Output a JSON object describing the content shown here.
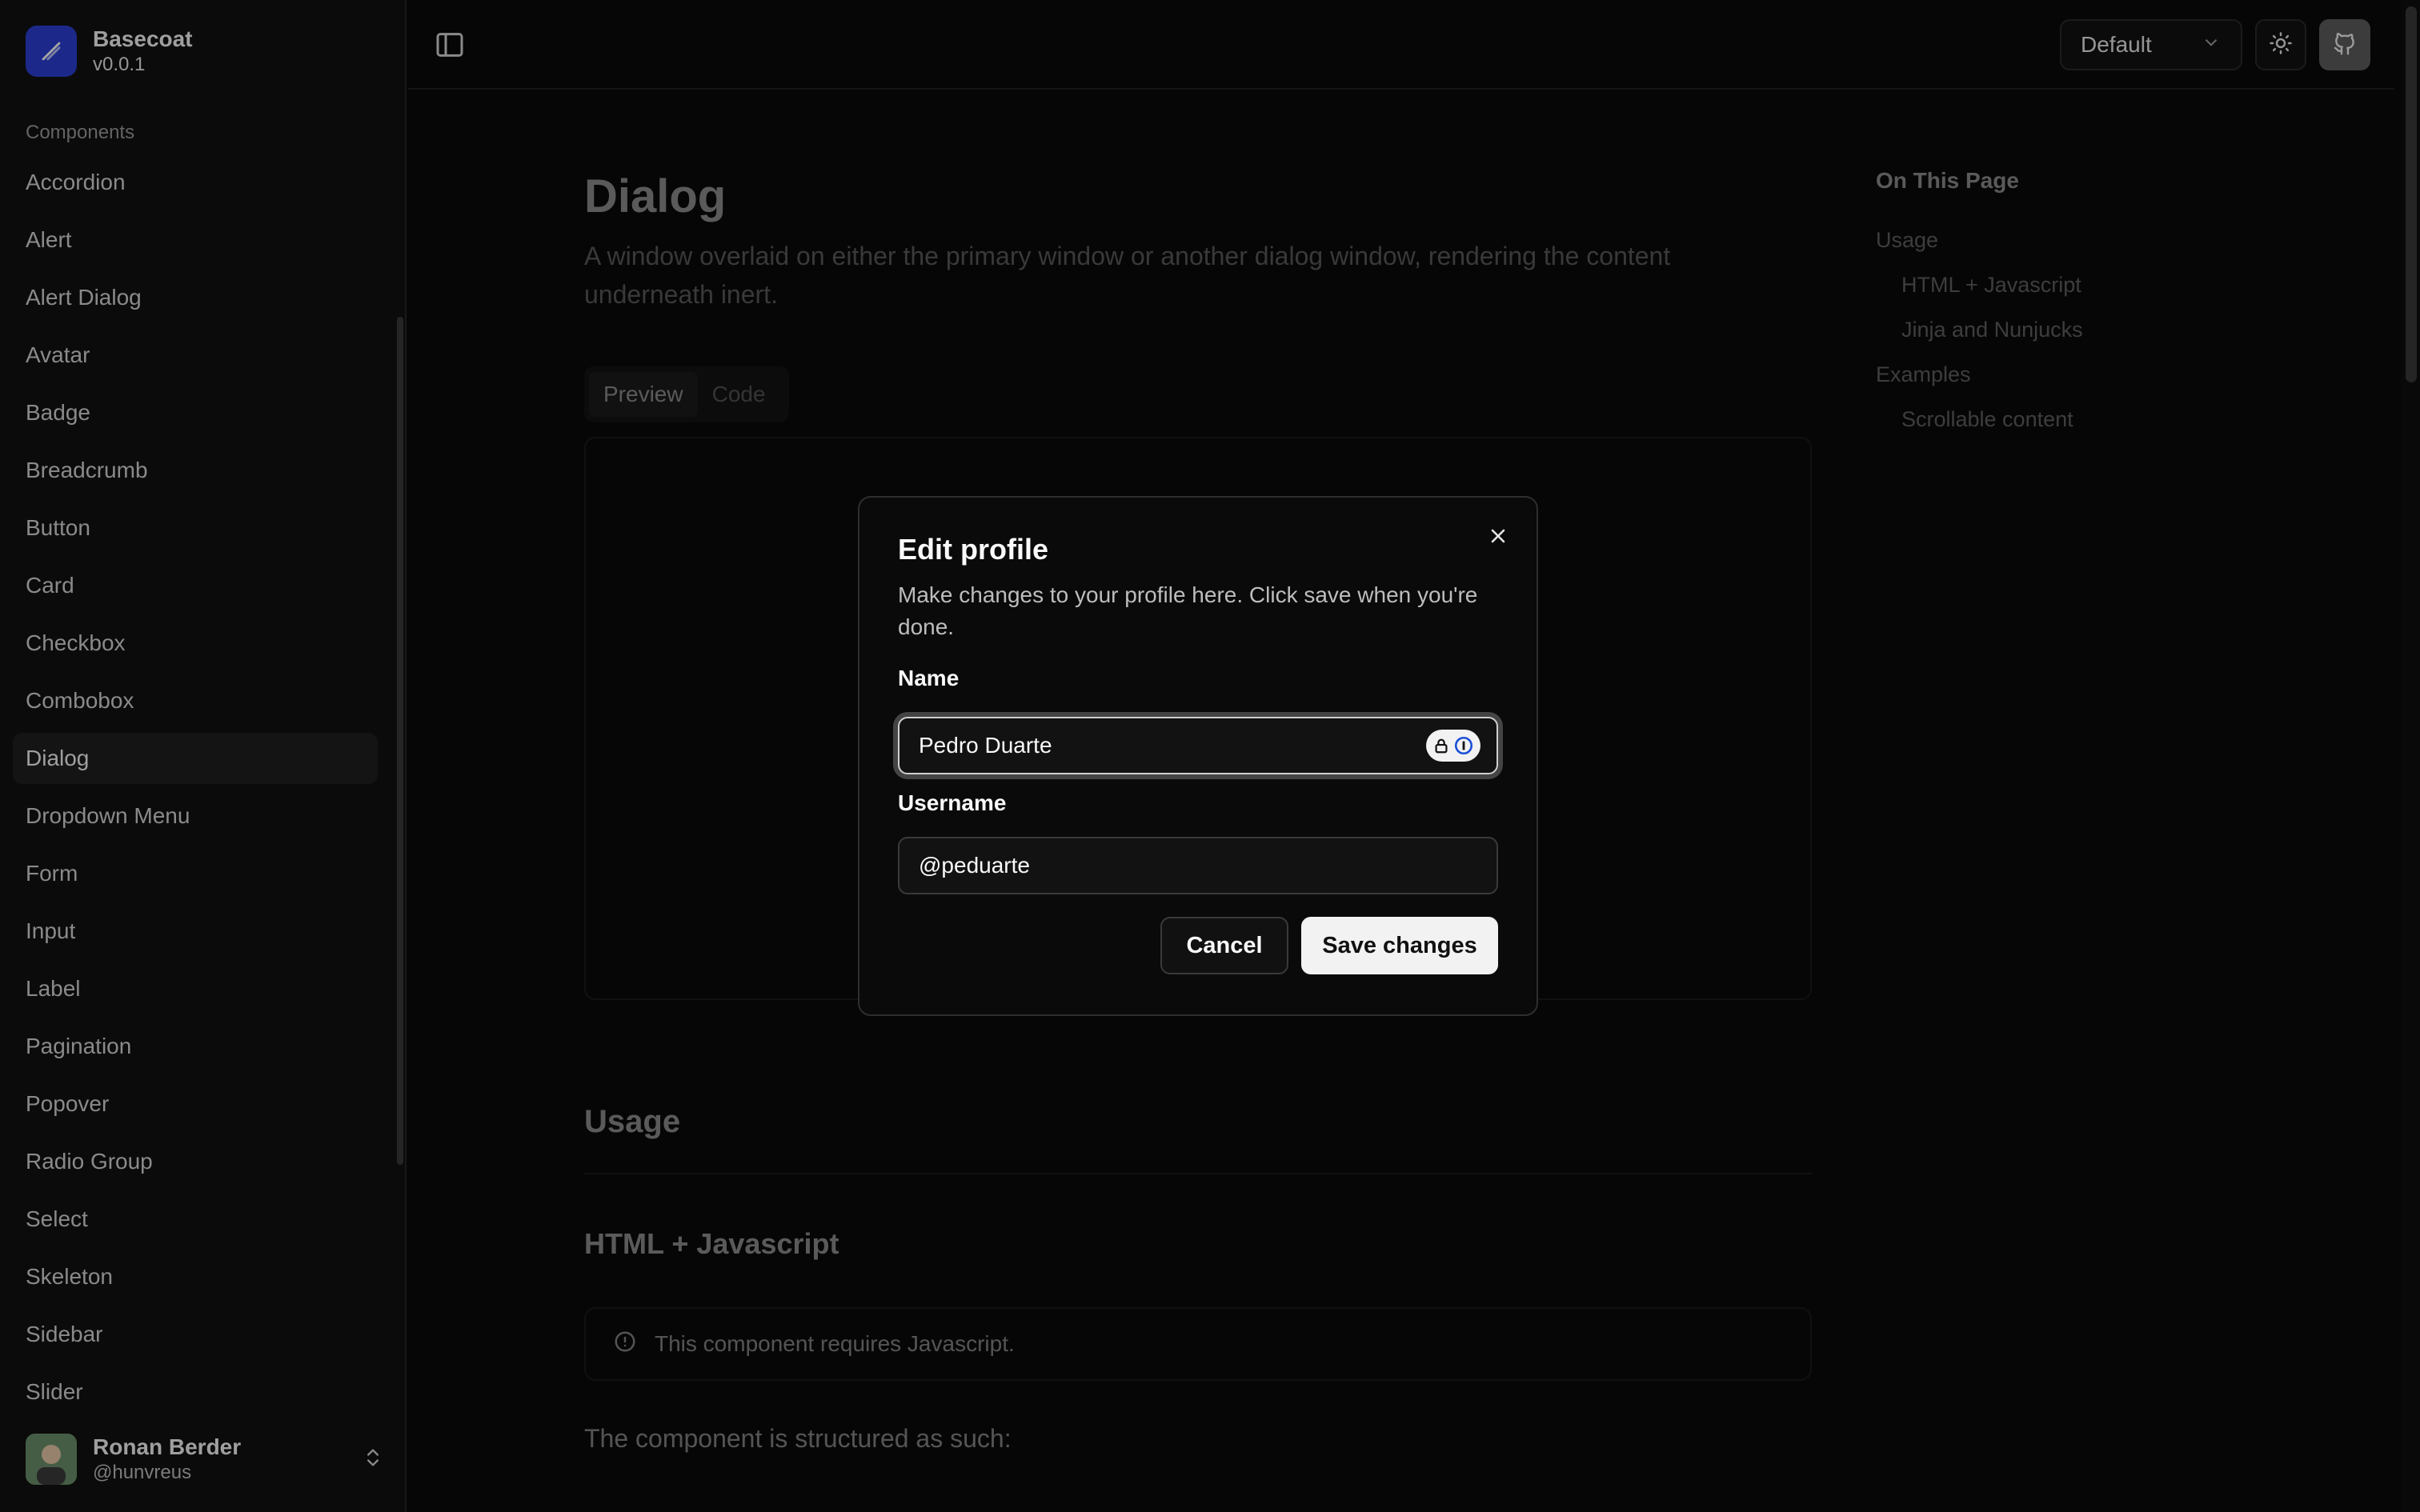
{
  "brand": {
    "name": "Basecoat",
    "version": "v0.0.1"
  },
  "sidebar": {
    "group_label": "Components",
    "items": [
      {
        "label": "Accordion"
      },
      {
        "label": "Alert"
      },
      {
        "label": "Alert Dialog"
      },
      {
        "label": "Avatar"
      },
      {
        "label": "Badge"
      },
      {
        "label": "Breadcrumb"
      },
      {
        "label": "Button"
      },
      {
        "label": "Card"
      },
      {
        "label": "Checkbox"
      },
      {
        "label": "Combobox"
      },
      {
        "label": "Dialog",
        "active": true
      },
      {
        "label": "Dropdown Menu"
      },
      {
        "label": "Form"
      },
      {
        "label": "Input"
      },
      {
        "label": "Label"
      },
      {
        "label": "Pagination"
      },
      {
        "label": "Popover"
      },
      {
        "label": "Radio Group"
      },
      {
        "label": "Select"
      },
      {
        "label": "Skeleton"
      },
      {
        "label": "Sidebar"
      },
      {
        "label": "Slider"
      }
    ],
    "user": {
      "name": "Ronan Berder",
      "handle": "@hunvreus"
    }
  },
  "header": {
    "theme_select": "Default"
  },
  "main": {
    "title": "Dialog",
    "description": "A window overlaid on either the primary window or another dialog window, rendering the content underneath inert.",
    "tabs": [
      {
        "label": "Preview",
        "active": true
      },
      {
        "label": "Code"
      }
    ],
    "usage_heading": "Usage",
    "html_js_heading": "HTML + Javascript",
    "alert_text": "This component requires Javascript.",
    "structure_text": "The component is structured as such:"
  },
  "toc": {
    "title": "On This Page",
    "items": [
      {
        "label": "Usage",
        "level": 1
      },
      {
        "label": "HTML + Javascript",
        "level": 2
      },
      {
        "label": "Jinja and Nunjucks",
        "level": 2
      },
      {
        "label": "Examples",
        "level": 1
      },
      {
        "label": "Scrollable content",
        "level": 2
      }
    ]
  },
  "dialog": {
    "title": "Edit profile",
    "description": "Make changes to your profile here. Click save when you're done.",
    "name_label": "Name",
    "name_value": "Pedro Duarte",
    "username_label": "Username",
    "username_value": "@peduarte",
    "cancel_label": "Cancel",
    "save_label": "Save changes"
  },
  "colors": {
    "brand": "#2b3fd6",
    "background": "#0a0a0a",
    "primary_button": "#f2f2f2"
  }
}
